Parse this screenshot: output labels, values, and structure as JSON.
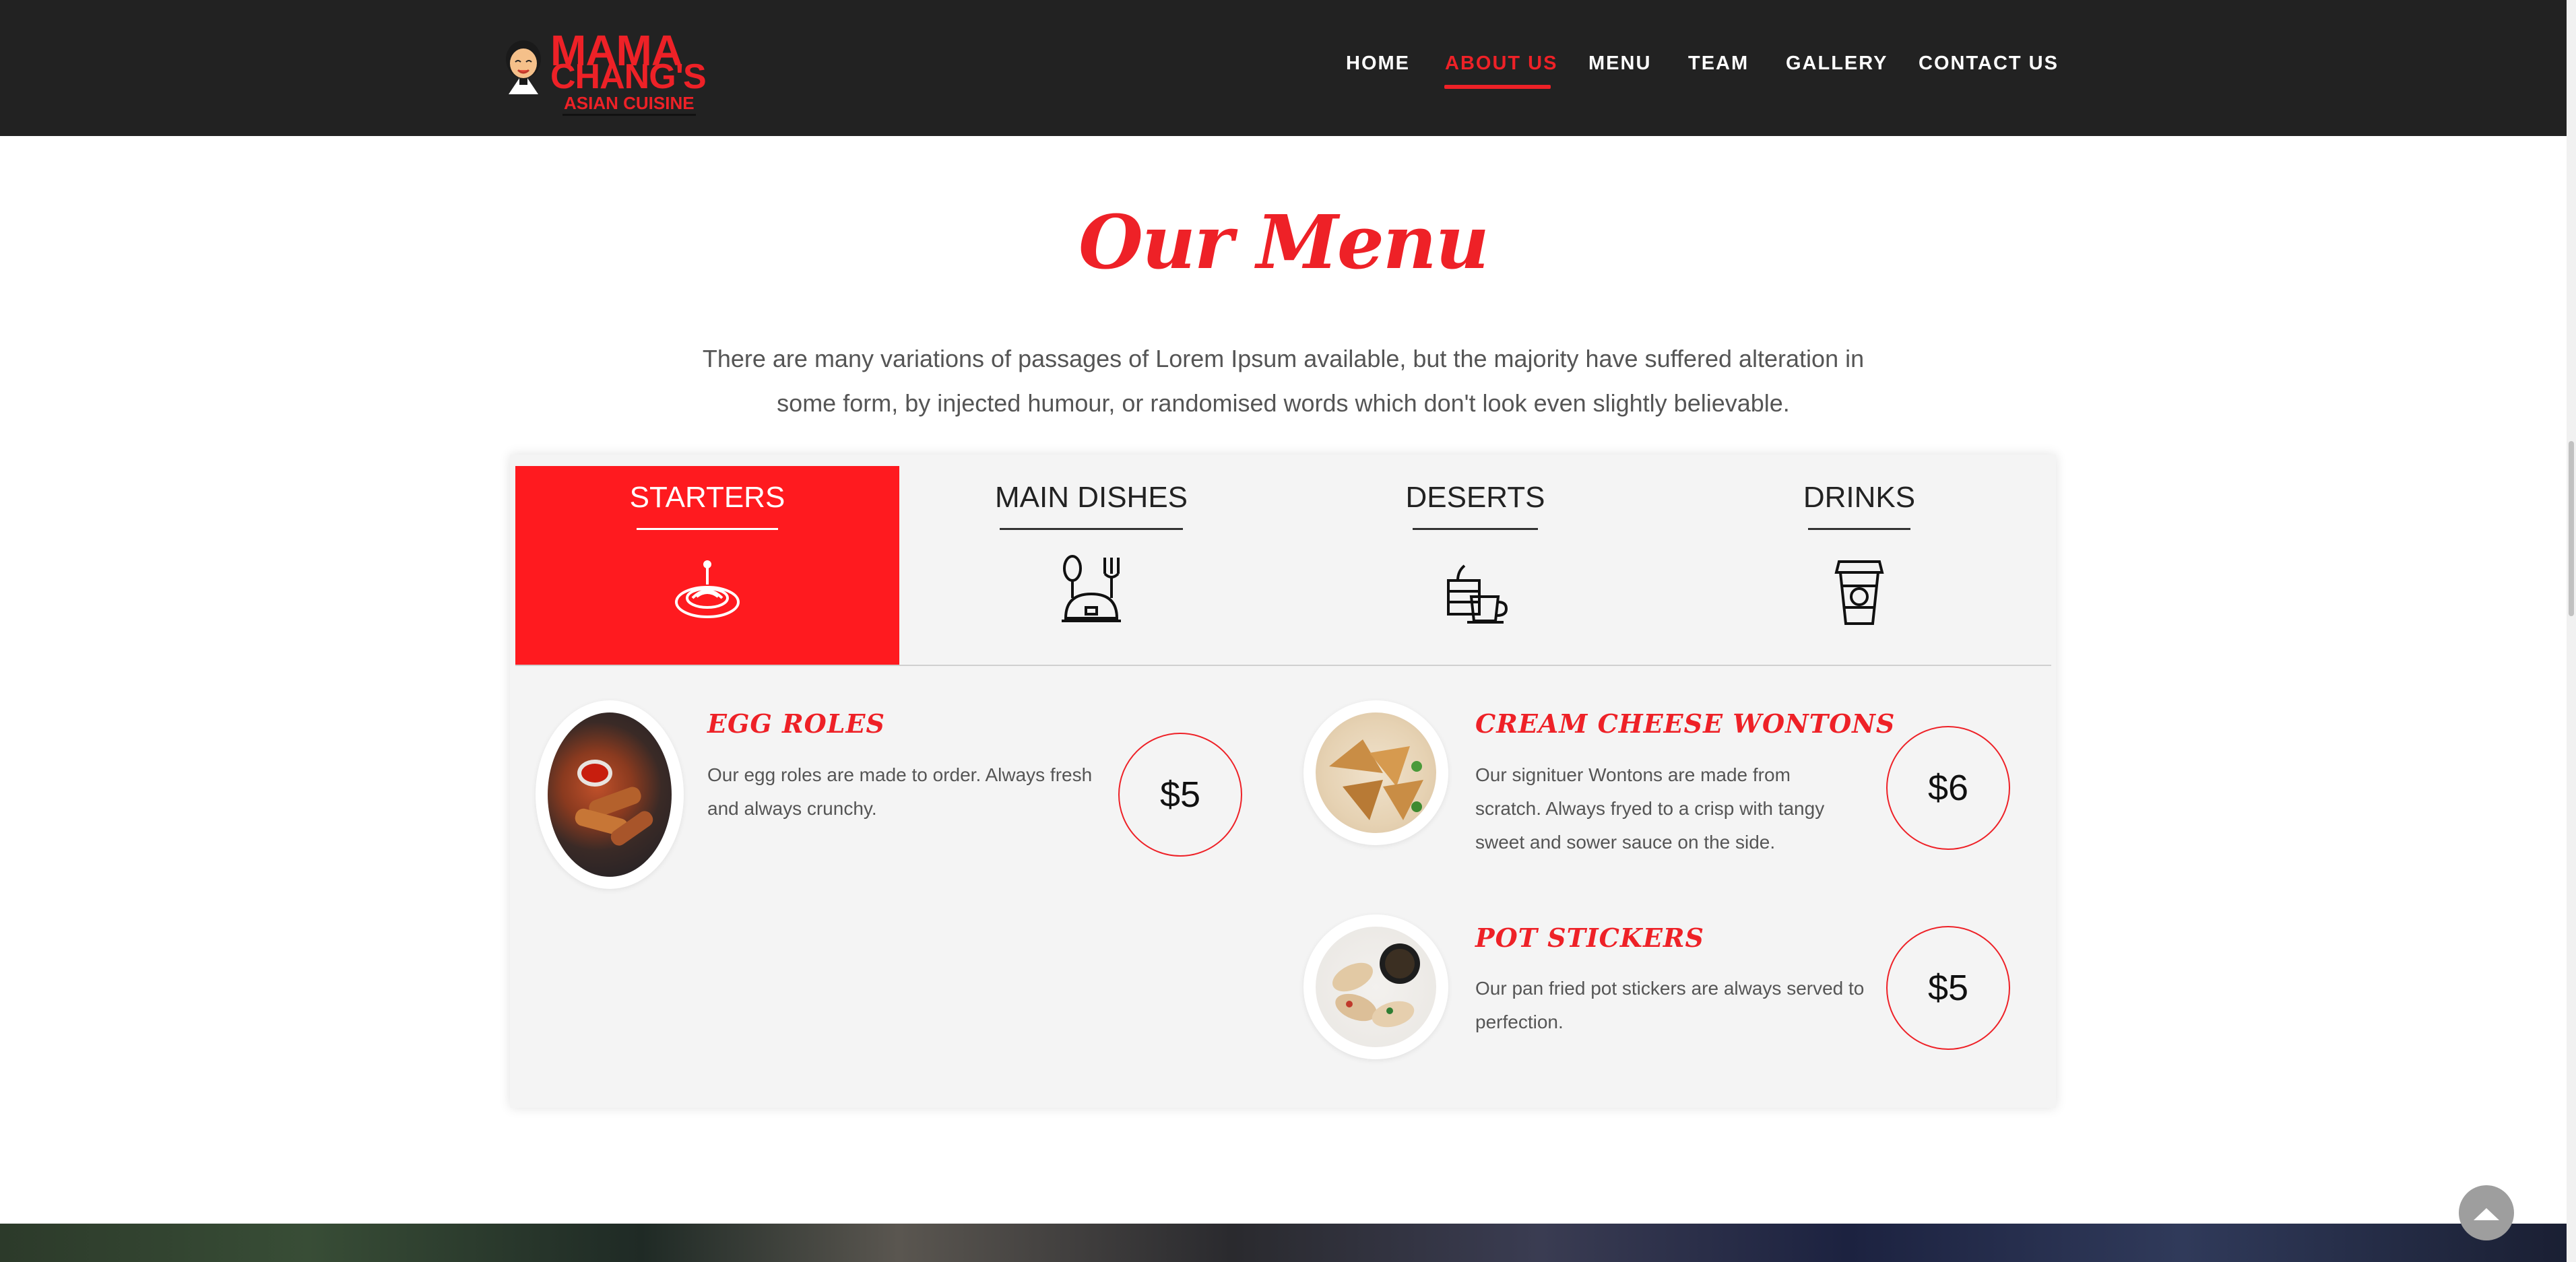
{
  "brand": {
    "line1": "MAMA",
    "line2": "CHANG'S",
    "line3": "ASIAN CUISINE"
  },
  "nav": [
    {
      "label": "HOME",
      "active": false
    },
    {
      "label": "ABOUT US",
      "active": true
    },
    {
      "label": "MENU",
      "active": false
    },
    {
      "label": "TEAM",
      "active": false
    },
    {
      "label": "GALLERY",
      "active": false
    },
    {
      "label": "CONTACT US",
      "active": false
    }
  ],
  "section": {
    "title": "Our Menu",
    "description": "There are many variations of passages of Lorem Ipsum available, but the majority have suffered alteration in some form, by injected humour, or randomised words which don't look even slightly believable."
  },
  "tabs": [
    {
      "label": "STARTERS",
      "icon": "pasta-plate-icon",
      "active": true
    },
    {
      "label": "MAIN DISHES",
      "icon": "cloche-cutlery-icon",
      "active": false
    },
    {
      "label": "DESERTS",
      "icon": "cake-coffee-icon",
      "active": false
    },
    {
      "label": "DRINKS",
      "icon": "takeaway-cup-icon",
      "active": false
    }
  ],
  "items": [
    {
      "name": "EGG ROLES",
      "description": "Our egg roles are made to order. Always fresh and always crunchy.",
      "price": "$5"
    },
    {
      "name": "CREAM CHEESE WONTONS",
      "description": "Our signituer Wontons are made from scratch. Always fryed to a crisp with tangy sweet and sower sauce on the side.",
      "price": "$6"
    },
    {
      "name": "POT STICKERS",
      "description": "Our pan fried pot stickers are always served to perfection.",
      "price": "$5"
    }
  ],
  "colors": {
    "accent": "#ee2127",
    "header_bg": "#222222",
    "panel_bg": "#f4f4f4"
  }
}
